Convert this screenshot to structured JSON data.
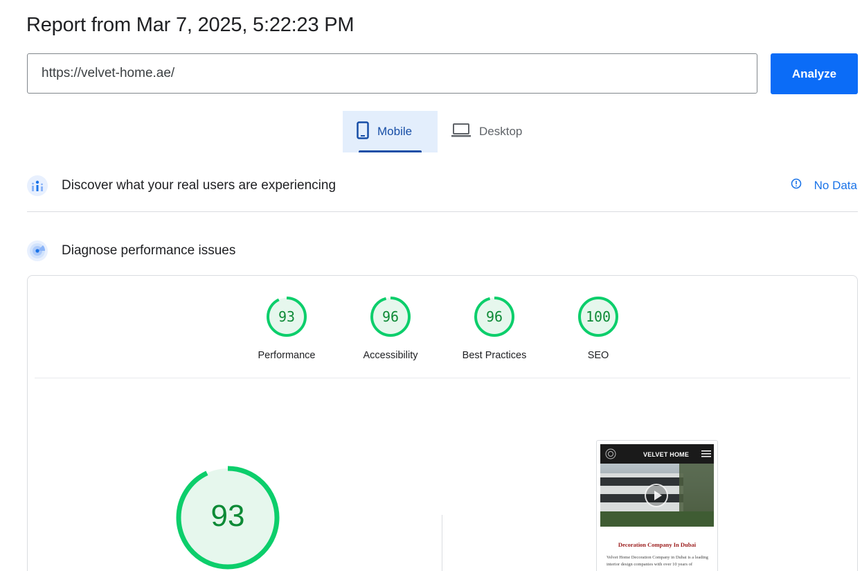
{
  "header": {
    "title": "Report from Mar 7, 2025, 5:22:23 PM"
  },
  "search": {
    "url": "https://velvet-home.ae/",
    "analyze_label": "Analyze"
  },
  "tabs": [
    {
      "label": "Mobile",
      "selected": true
    },
    {
      "label": "Desktop",
      "selected": false
    }
  ],
  "field_data": {
    "title": "Discover what your real users are experiencing",
    "status": "No Data"
  },
  "lab_data": {
    "title": "Diagnose performance issues"
  },
  "scores": [
    {
      "label": "Performance",
      "value": 93
    },
    {
      "label": "Accessibility",
      "value": 96
    },
    {
      "label": "Best Practices",
      "value": 96
    },
    {
      "label": "SEO",
      "value": 100
    }
  ],
  "performance_gauge": {
    "value": 93
  },
  "screenshot_preview": {
    "brand": "VELVET HOME",
    "heading": "Decoration Company In Dubai",
    "body": "Velvet Home Decoration Company in Dubai is a leading interior design companies with over 10 years of"
  },
  "colors": {
    "accent": "#0b6cf7",
    "good_score": "#0cce6b",
    "good_score_text": "#0d8a36",
    "tab_selected_bg": "#e3eefc",
    "link": "#1a73e8"
  }
}
